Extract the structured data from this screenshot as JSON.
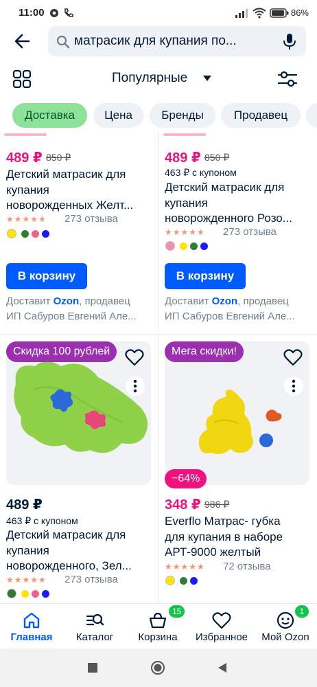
{
  "status_bar": {
    "time": "11:00",
    "battery": "86%"
  },
  "search": {
    "query": "матрасик для купания по..."
  },
  "toolbar": {
    "sort_label": "Популярные"
  },
  "chips": [
    {
      "label": "Доставка"
    },
    {
      "label": "Цена"
    },
    {
      "label": "Бренды"
    },
    {
      "label": "Продавец"
    }
  ],
  "products": [
    {
      "price": "489 ₽",
      "old_price": "850 ₽",
      "title_line1": "Детский матрасик для",
      "title_line2": "купания",
      "title_line3": "новорожденных Желт...",
      "reviews": "273 отзыва",
      "cart_label": "В корзину",
      "deliv_prefix": "Доставит ",
      "deliv_brand": "Ozon",
      "deliv_suffix": ", продавец",
      "seller": "ИП Сабуров Евгений Але...",
      "colors": [
        "#ffe600",
        "#2e7d32",
        "#f06292",
        "#1a1aff"
      ]
    },
    {
      "price": "489 ₽",
      "old_price": "850 ₽",
      "coupon": "463 ₽ с купоном",
      "title_line1": "Детский матрасик для",
      "title_line2": "купания",
      "title_line3": "новорожденного Розо...",
      "reviews": "273 отзыва",
      "cart_label": "В корзину",
      "deliv_prefix": "Доставит ",
      "deliv_brand": "Ozon",
      "deliv_suffix": ", продавец",
      "seller": "ИП Сабуров Евгений Але...",
      "colors": [
        "#f48fb1",
        "#ffe600",
        "#2e7d32",
        "#1a1aff"
      ]
    },
    {
      "promo": "Скидка 100 рублей",
      "price": "489 ₽",
      "coupon": "463 ₽ с купоном",
      "title_line1": "Детский матрасик для",
      "title_line2": "купания",
      "title_line3": "новорожденного, Зел...",
      "reviews": "273 отзыва",
      "colors": [
        "#2e7d32",
        "#ffe600",
        "#f06292",
        "#1a1aff"
      ]
    },
    {
      "promo": "Мега скидки!",
      "discount": "−64%",
      "price": "348 ₽",
      "old_price": "986 ₽",
      "title_line1": "Everflo Матрас- губка",
      "title_line2": "для купания в наборе",
      "title_line3": "АРТ-9000 желтый",
      "reviews": "72 отзыва",
      "colors": [
        "#ffe600",
        "#2e7d32",
        "#1a1aff"
      ]
    }
  ],
  "bottom_nav": [
    {
      "label": "Главная"
    },
    {
      "label": "Каталог"
    },
    {
      "label": "Корзина",
      "badge": "15"
    },
    {
      "label": "Избранное"
    },
    {
      "label": "Мой Ozon",
      "badge": "1"
    }
  ],
  "rating_stars": "★★★★★"
}
